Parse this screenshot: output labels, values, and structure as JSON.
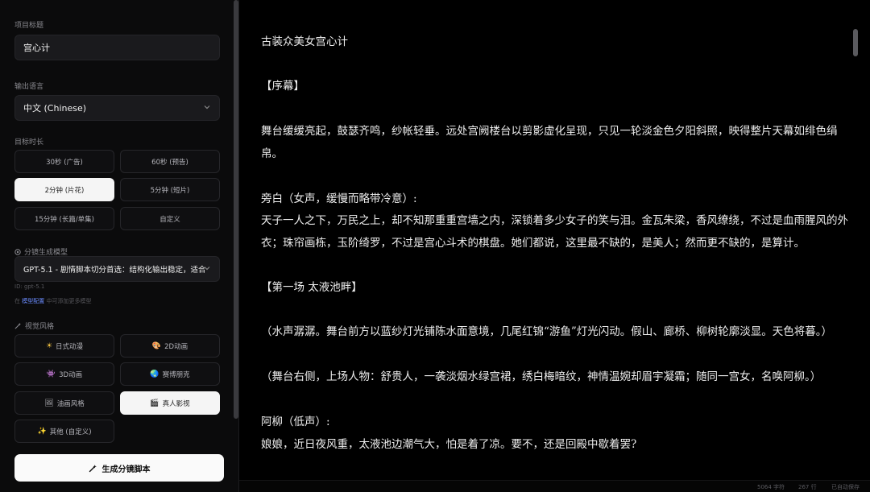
{
  "left": {
    "title_label": "项目标题",
    "title_value": "宫心计",
    "language_label": "输出语言",
    "language_value": "中文 (Chinese)",
    "duration_label": "目标时长",
    "durations": [
      "30秒 (广告)",
      "60秒 (预告)",
      "2分钟 (片花)",
      "5分钟 (短片)",
      "15分钟 (长篇/单集)",
      "自定义"
    ],
    "active_duration": "2分钟 (片花)",
    "model_label": "分镜生成模型",
    "model_value": "GPT-5.1 - 剧情脚本切分首选：结构化输出稳定，适合",
    "model_id": "ID: gpt-5.1",
    "model_hint_pre": "在",
    "model_hint_link": "模型配置",
    "model_hint_post": "中可添加更多模型",
    "style_label": "视觉风格",
    "styles": [
      {
        "icon": "sun-icon",
        "glyph": "☀",
        "label": "日式动漫"
      },
      {
        "icon": "palette-icon",
        "glyph": "🎨",
        "label": "2D动画"
      },
      {
        "icon": "cube-icon",
        "glyph": "👾",
        "label": "3D动画"
      },
      {
        "icon": "globe-icon",
        "glyph": "🌏",
        "label": "赛博朋克"
      },
      {
        "icon": "picture-icon",
        "glyph": "🖼",
        "label": "油画风格"
      },
      {
        "icon": "clapper-icon",
        "glyph": "🎬",
        "label": "真人影视"
      },
      {
        "icon": "sparkle-icon",
        "glyph": "✨",
        "label": "其他 (自定义)"
      }
    ],
    "active_style": "真人影视",
    "generate_label": "生成分镜脚本"
  },
  "document": {
    "lines": [
      "古装众美女宫心计",
      "【序幕】",
      "舞台缓缓亮起，鼓瑟齐鸣，纱帐轻垂。远处宫阙楼台以剪影虚化呈现，只见一轮淡金色夕阳斜照，映得整片天幕如绯色绢帛。",
      "旁白（女声，缓慢而略带冷意）:",
      "天子一人之下，万民之上，却不知那重重宫墙之内，深锁着多少女子的笑与泪。金瓦朱梁，香风缭绕，不过是血雨腥风的外衣；珠帘画栋，玉阶绮罗，不过是宫心斗术的棋盘。她们都说，这里最不缺的，是美人；然而更不缺的，是算计。",
      "【第一场 太液池畔】",
      "（水声潺潺。舞台前方以蓝纱灯光铺陈水面意境，几尾红锦“游鱼”灯光闪动。假山、廊桥、柳树轮廓淡显。天色将暮。）",
      "（舞台右侧，上场人物：舒贵人，一袭淡烟水绿宫裙，绣白梅暗纹，神情温婉却眉宇凝霜；随同一宫女，名唤阿柳。）",
      "阿柳（低声）:",
      "娘娘，近日夜风重，太液池边潮气大，怕是着了凉。要不，还是回殿中歇着罢?"
    ]
  },
  "footer": {
    "chars": "5064 字符",
    "lines": "267 行",
    "status": "已自动保存"
  }
}
